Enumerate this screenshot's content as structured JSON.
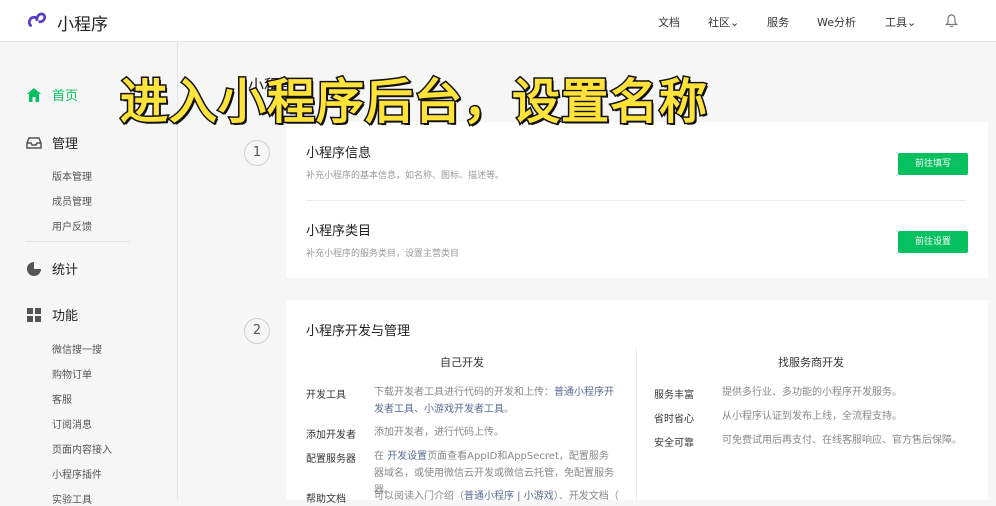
{
  "header": {
    "brand": "小程序",
    "nav": [
      "文档",
      "社区",
      "服务",
      "We分析",
      "工具"
    ]
  },
  "sidebar": {
    "home": "首页",
    "manage": "管理",
    "manage_items": [
      "版本管理",
      "成员管理",
      "用户反馈"
    ],
    "stats": "统计",
    "features": "功能",
    "feature_items": [
      "微信搜一搜",
      "购物订单",
      "客服",
      "订阅消息",
      "页面内容接入",
      "小程序插件",
      "实验工具"
    ]
  },
  "main": {
    "bg_title": "小程序",
    "step1": {
      "num": "1",
      "info_title": "小程序信息",
      "info_desc": "补充小程序的基本信息，如名称、图标、描述等。",
      "info_button": "前往填写",
      "category_title": "小程序类目",
      "category_desc": "补充小程序的服务类目，设置主营类目",
      "category_button": "前往设置"
    },
    "step2": {
      "num": "2",
      "title": "小程序开发与管理",
      "left_heading": "自己开发",
      "right_heading": "找服务商开发",
      "left_rows": [
        {
          "label": "开发工具",
          "pre": "下载开发者工具进行代码的开发和上传：",
          "link": "普通小程序开发者工具、小游戏开发者工具",
          "post": "。"
        },
        {
          "label": "添加开发者",
          "pre": "添加开发者，进行代码上传。",
          "link": "",
          "post": ""
        },
        {
          "label": "配置服务器",
          "pre": "在 ",
          "link": "开发设置",
          "post": "页面查看AppID和AppSecret，配置服务器域名，或使用微信云开发或微信云托管，免配置服务器。"
        },
        {
          "label": "帮助文档",
          "pre": "可以阅读入门介绍（",
          "link": "普通小程序 | 小游戏",
          "post": "）、开发文档（"
        }
      ],
      "right_rows": [
        {
          "label": "服务丰富",
          "text": "提供多行业、多功能的小程序开发服务。"
        },
        {
          "label": "省时省心",
          "text": "从小程序认证到发布上线，全流程支持。"
        },
        {
          "label": "安全可靠",
          "text": "可免费试用后再支付、在线客服响应、官方售后保障。"
        }
      ]
    }
  },
  "overlay_caption": "进入小程序后台，设置名称",
  "colors": {
    "accent": "#07c160",
    "link": "#576b95",
    "caption": "#ffe23a"
  }
}
